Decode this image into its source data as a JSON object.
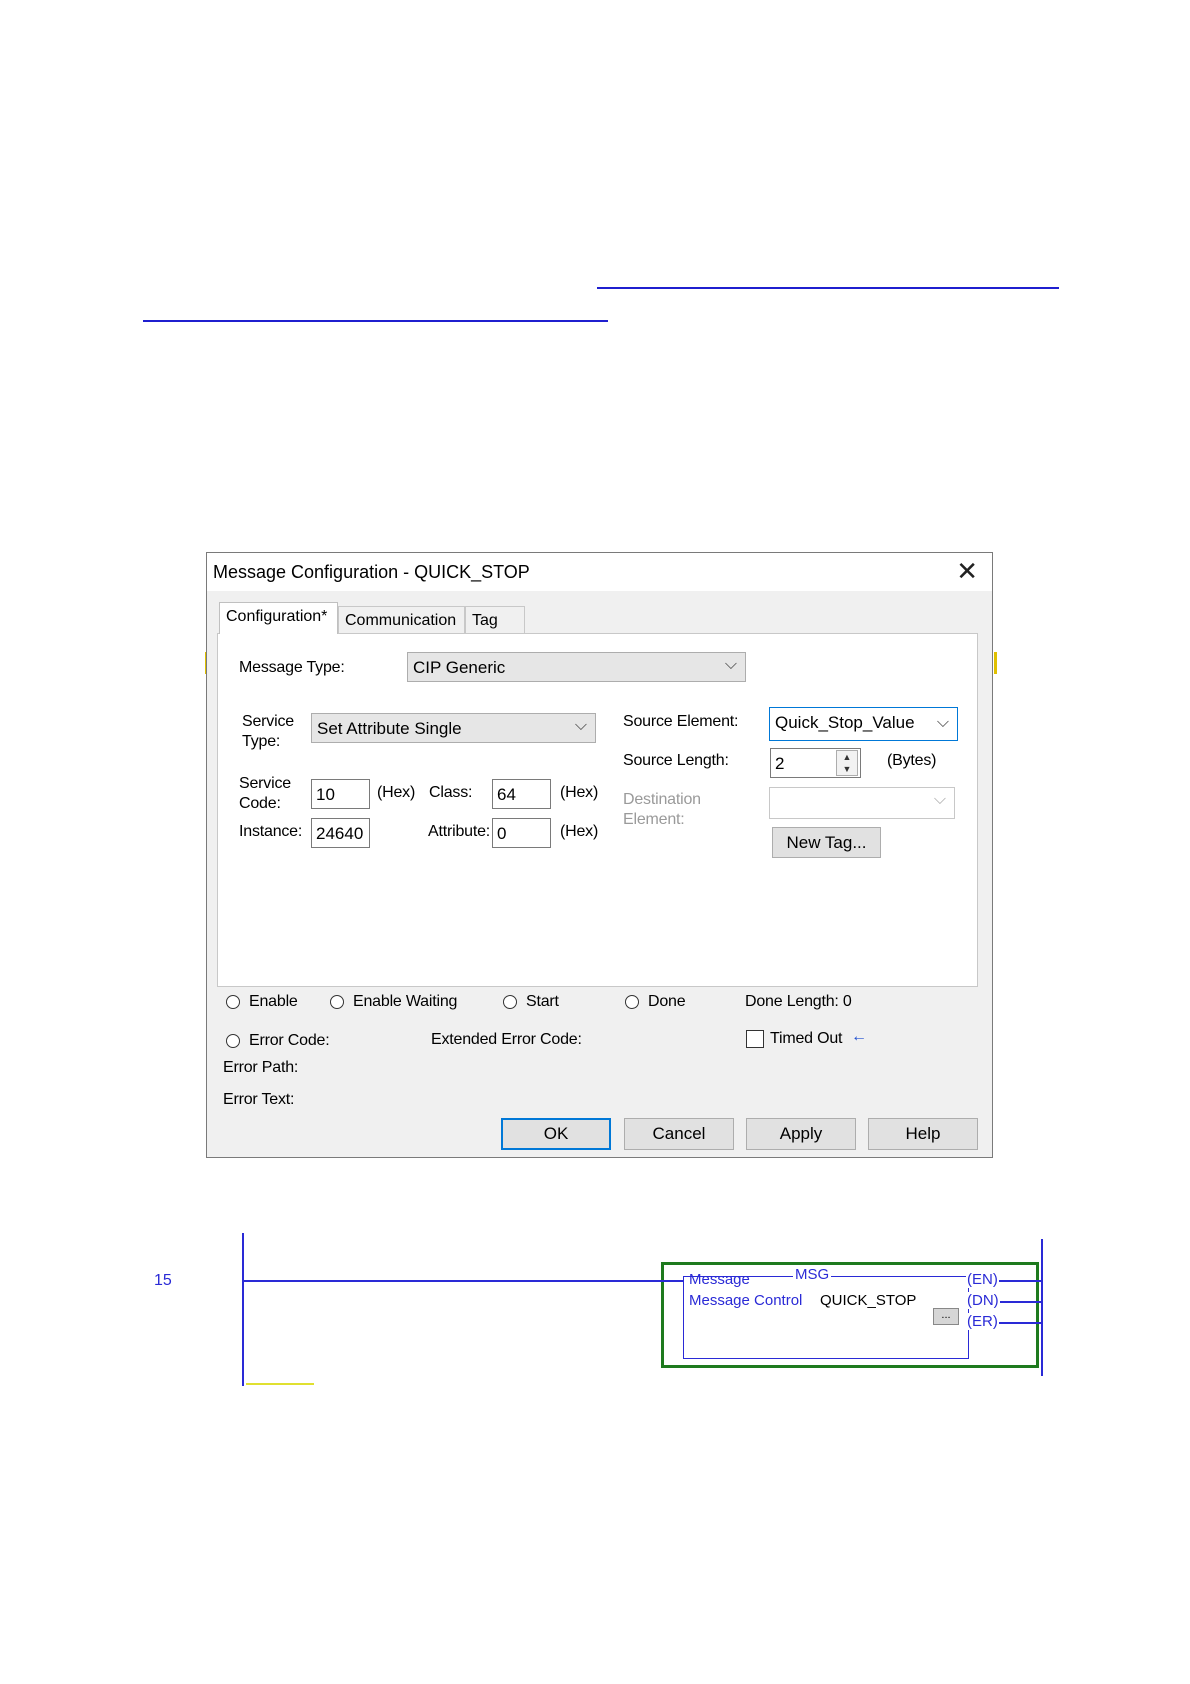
{
  "dialog": {
    "title": "Message Configuration - QUICK_STOP",
    "close_glyph": "✕",
    "tabs": [
      {
        "label": "Configuration*"
      },
      {
        "label": "Communication"
      },
      {
        "label": "Tag"
      }
    ],
    "message_type": {
      "label": "Message Type:",
      "value": "CIP Generic"
    },
    "service_type": {
      "label_line1": "Service",
      "label_line2": "Type:",
      "value": "Set Attribute Single"
    },
    "service_code": {
      "label_line1": "Service",
      "label_line2": "Code:",
      "value": "10",
      "unit": "(Hex)"
    },
    "class": {
      "label": "Class:",
      "value": "64",
      "unit": "(Hex)"
    },
    "instance": {
      "label": "Instance:",
      "value": "24640"
    },
    "attribute": {
      "label": "Attribute:",
      "value": "0",
      "unit": "(Hex)"
    },
    "source_element": {
      "label": "Source Element:",
      "value": "Quick_Stop_Value"
    },
    "source_length": {
      "label": "Source Length:",
      "value": "2",
      "unit": "(Bytes)"
    },
    "destination_element": {
      "label_line1": "Destination",
      "label_line2": "Element:",
      "value": ""
    },
    "new_tag_button": "New Tag...",
    "status": {
      "enable": "Enable",
      "enable_waiting": "Enable Waiting",
      "start": "Start",
      "done": "Done",
      "done_length": "Done Length:  0",
      "error_code": "Error Code:",
      "extended_error_code": "Extended Error Code:",
      "timed_out": "Timed Out",
      "error_path": "Error Path:",
      "error_text": "Error Text:"
    },
    "buttons": {
      "ok": "OK",
      "cancel": "Cancel",
      "apply": "Apply",
      "help": "Help"
    }
  },
  "ladder": {
    "rung_number": "15",
    "instruction": "MSG",
    "row1_label": "Message",
    "row2_label": "Message Control",
    "row2_value": "QUICK_STOP",
    "browse_glyph": "...",
    "outputs": [
      "EN",
      "DN",
      "ER"
    ]
  },
  "colors": {
    "link_blue": "#1f1fcf",
    "ladder_blue": "#2a2ad6",
    "msg_border_green": "#1e7a1e",
    "focus_blue": "#0078d7"
  }
}
